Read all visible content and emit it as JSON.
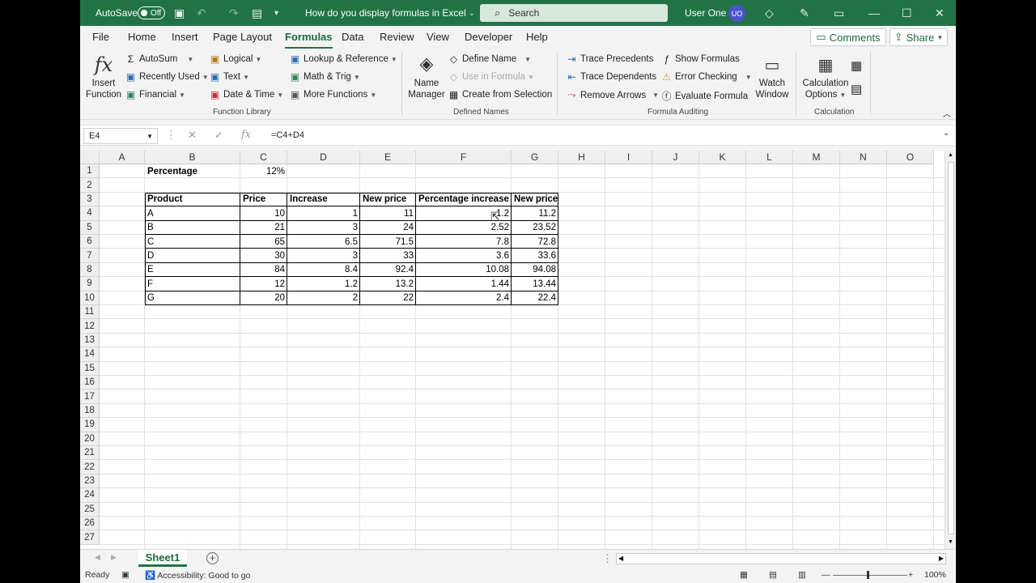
{
  "titlebar": {
    "autosave_label": "AutoSave",
    "autosave_state": "Off",
    "doc_title": "How do you display formulas in Excel",
    "search_placeholder": "Search",
    "user_name": "User One",
    "user_initials": "UO"
  },
  "tabs": [
    "File",
    "Home",
    "Insert",
    "Page Layout",
    "Formulas",
    "Data",
    "Review",
    "View",
    "Developer",
    "Help"
  ],
  "active_tab": "Formulas",
  "buttons": {
    "comments": "Comments",
    "share": "Share"
  },
  "ribbon": {
    "insert_function": [
      "Insert",
      "Function"
    ],
    "function_library": [
      "AutoSum",
      "Recently Used",
      "Financial",
      "Logical",
      "Text",
      "Date & Time",
      "Lookup & Reference",
      "Math & Trig",
      "More Functions"
    ],
    "name_manager": [
      "Name",
      "Manager"
    ],
    "defined_names": [
      "Define Name",
      "Use in Formula",
      "Create from Selection"
    ],
    "formula_auditing": [
      "Trace Precedents",
      "Trace Dependents",
      "Remove Arrows",
      "Show Formulas",
      "Error Checking",
      "Evaluate Formula"
    ],
    "watch_window": [
      "Watch",
      "Window"
    ],
    "calculation_options": [
      "Calculation",
      "Options"
    ],
    "groups": [
      "Function Library",
      "Defined Names",
      "Formula Auditing",
      "Calculation"
    ]
  },
  "formula_bar": {
    "name_box": "E4",
    "formula": "=C4+D4",
    "fx": "fx"
  },
  "grid": {
    "columns": [
      "A",
      "B",
      "C",
      "D",
      "E",
      "F",
      "G",
      "H",
      "I",
      "J",
      "K",
      "L",
      "M",
      "N",
      "O"
    ],
    "rows": [
      "1",
      "2",
      "3",
      "4",
      "5",
      "6",
      "7",
      "8",
      "9",
      "10",
      "11",
      "12",
      "13",
      "14",
      "15",
      "16",
      "17",
      "18",
      "19",
      "20",
      "21",
      "22",
      "23",
      "24",
      "25",
      "26",
      "27"
    ],
    "percentage_label": "Percentage",
    "percentage_value": "12%",
    "headers": [
      "Product",
      "Price",
      "Increase",
      "New price",
      "Percentage increase",
      "New price"
    ],
    "data": [
      [
        "A",
        "10",
        "1",
        "11",
        "1.2",
        "11.2"
      ],
      [
        "B",
        "21",
        "3",
        "24",
        "2.52",
        "23.52"
      ],
      [
        "C",
        "65",
        "6.5",
        "71.5",
        "7.8",
        "72.8"
      ],
      [
        "D",
        "30",
        "3",
        "33",
        "3.6",
        "33.6"
      ],
      [
        "E",
        "84",
        "8.4",
        "92.4",
        "10.08",
        "94.08"
      ],
      [
        "F",
        "12",
        "1.2",
        "13.2",
        "1.44",
        "13.44"
      ],
      [
        "G",
        "20",
        "2",
        "22",
        "2.4",
        "22.4"
      ]
    ]
  },
  "sheets": [
    "Sheet1"
  ],
  "status": {
    "ready": "Ready",
    "accessibility": "Accessibility: Good to go",
    "zoom": "100%"
  }
}
